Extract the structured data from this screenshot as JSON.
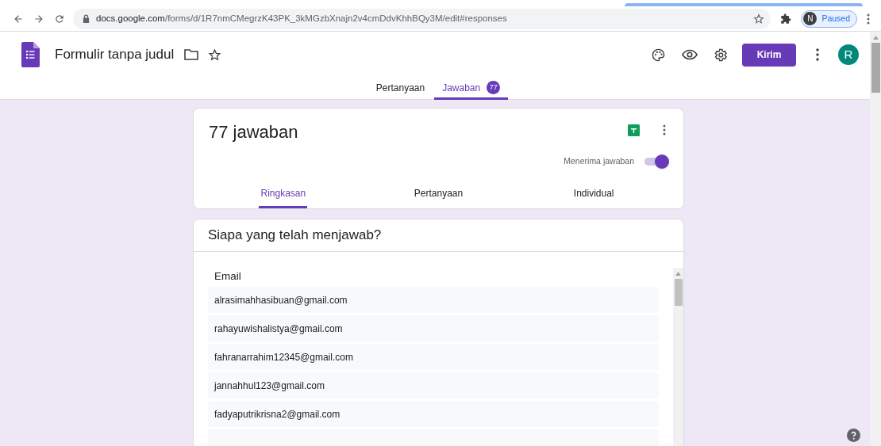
{
  "browser": {
    "url_host": "docs.google.com",
    "url_path": "/forms/d/1R7nmCMegrzK43PK_3kMGzbXnajn2v4cmDdvKhhBQy3M/edit#responses",
    "profile_initial": "N",
    "profile_status": "Paused"
  },
  "header": {
    "title": "Formulir tanpa judul",
    "send_button": "Kirim",
    "avatar_initial": "R"
  },
  "tabs": [
    {
      "label": "Pertanyaan",
      "selected": false
    },
    {
      "label": "Jawaban",
      "selected": true,
      "badge": "77"
    }
  ],
  "summary": {
    "title": "77 jawaban",
    "accepting_label": "Menerima jawaban",
    "accepting_on": true,
    "subtabs": [
      {
        "label": "Ringkasan",
        "selected": true
      },
      {
        "label": "Pertanyaan",
        "selected": false
      },
      {
        "label": "Individual",
        "selected": false
      }
    ]
  },
  "respondents": {
    "title": "Siapa yang telah menjawab?",
    "column": "Email",
    "rows": [
      "alrasimahhasibuan@gmail.com",
      "rahayuwishalistya@gmail.com",
      "fahranarrahim12345@gmail.com",
      "jannahhul123@gmail.com",
      "fadyaputrikrisna2@gmail.com"
    ]
  }
}
